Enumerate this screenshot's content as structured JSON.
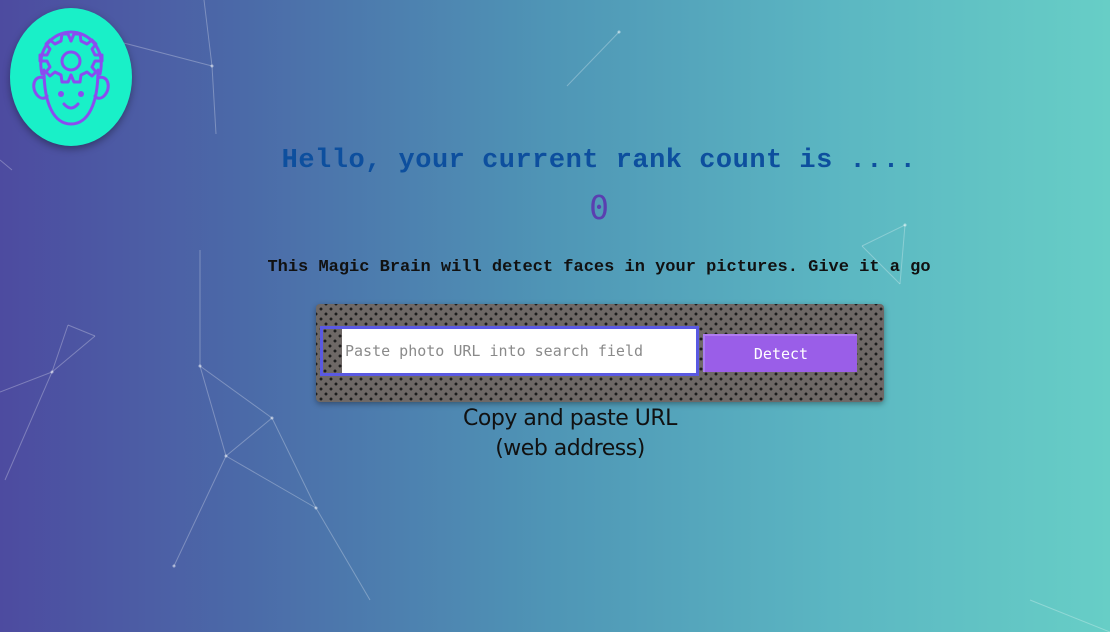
{
  "logo": {
    "icon": "brain-face-icon",
    "bg_color": "#19f0c8",
    "stroke_color": "#8a4cf0"
  },
  "greeting": "Hello, your current rank count is ....",
  "rank_count": "0",
  "description": "This Magic Brain will detect faces in your pictures. Give it a go",
  "form": {
    "input_placeholder": "Paste photo URL into search field",
    "input_value": "",
    "button_label": "Detect",
    "accent_color": "#9a5ee8"
  },
  "hint": {
    "line1": "Copy and paste URL",
    "line2": "(web address)"
  }
}
